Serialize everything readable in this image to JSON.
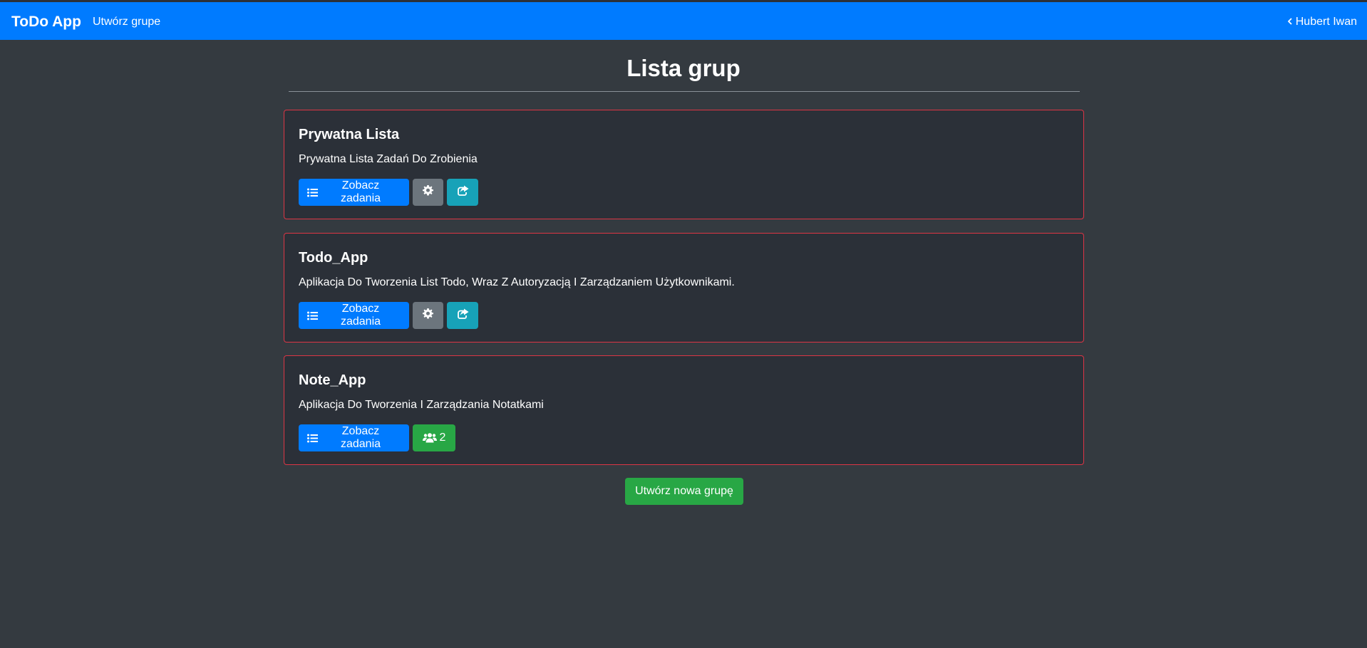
{
  "navbar": {
    "brand": "ToDo App",
    "create_group_link": "Utwórz grupe",
    "user_name": "Hubert Iwan"
  },
  "page": {
    "title": "Lista grup"
  },
  "groups": [
    {
      "name": "Prywatna Lista",
      "description": "Prywatna Lista Zadań Do Zrobienia",
      "view_tasks_label": "Zobacz zadania",
      "actions": [
        "settings",
        "share"
      ]
    },
    {
      "name": "Todo_App",
      "description": "Aplikacja Do Tworzenia List Todo, Wraz Z Autoryzacją I Zarządzaniem Użytkownikami.",
      "view_tasks_label": "Zobacz zadania",
      "actions": [
        "settings",
        "share"
      ]
    },
    {
      "name": "Note_App",
      "description": "Aplikacja Do Tworzenia I Zarządzania Notatkami",
      "view_tasks_label": "Zobacz zadania",
      "members_count": "2",
      "actions": [
        "members"
      ]
    }
  ],
  "footer": {
    "create_group_button": "Utwórz nowa grupę"
  },
  "colors": {
    "primary": "#007bff",
    "secondary": "#6c757d",
    "info": "#17a2b8",
    "success": "#28a745",
    "card_border": "#dc3545",
    "background": "#343a40"
  }
}
